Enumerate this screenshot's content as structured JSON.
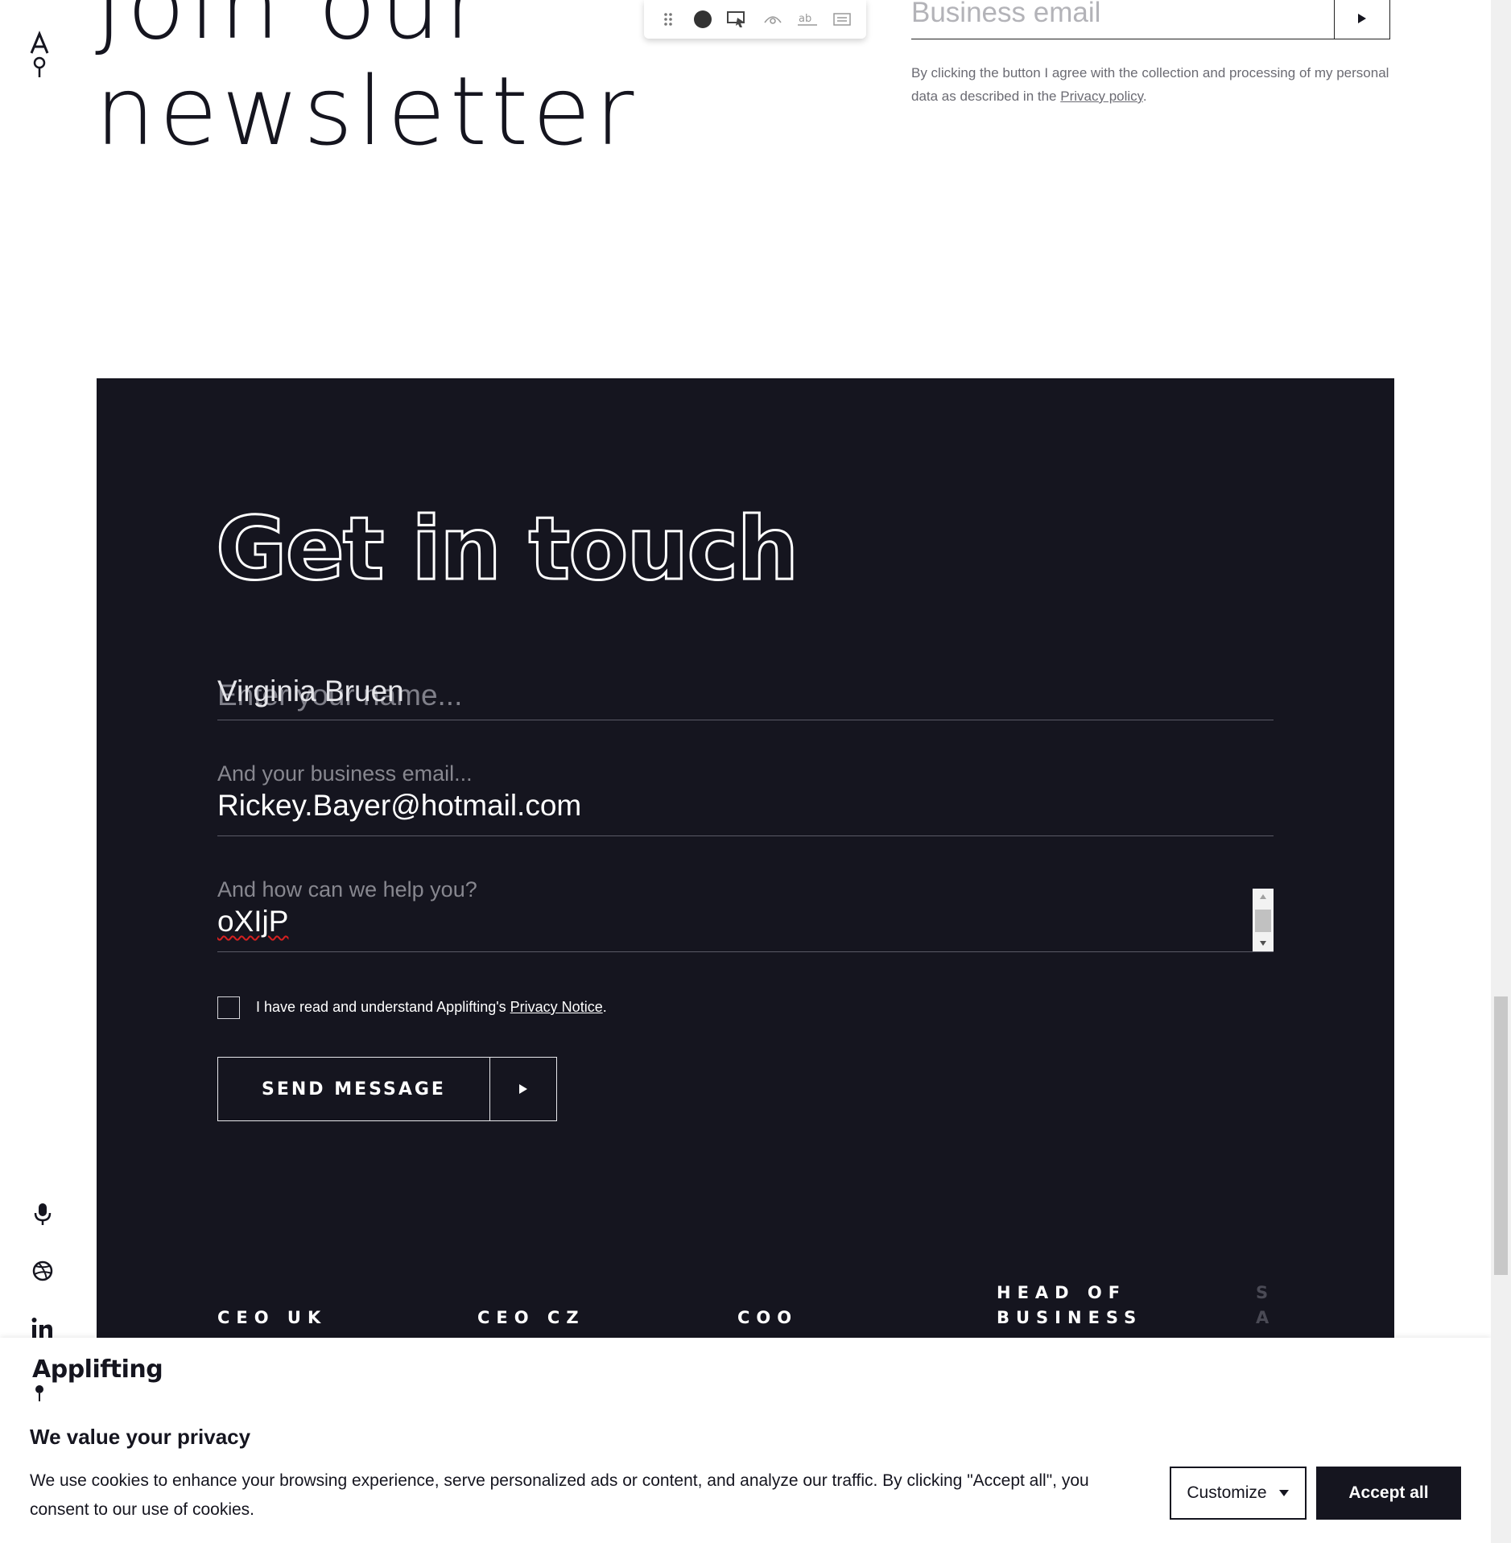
{
  "newsletter": {
    "title_line1": "Join our",
    "title_line2": "newsletter",
    "email_placeholder": "Business email",
    "consent_prefix": "By clicking the button I agree with the collection and processing of my personal data as described in the ",
    "consent_link": "Privacy policy",
    "consent_suffix": "."
  },
  "toolbar": {
    "icons": [
      "drag-handle-icon",
      "record-icon",
      "select-element-icon",
      "eye-icon",
      "text-icon",
      "comment-icon"
    ]
  },
  "contact": {
    "title": "Get in touch",
    "name_placeholder": "Enter your name...",
    "name_value": "Virginia Bruen",
    "email_label": "And your business email...",
    "email_value": "Rickey.Bayer@hotmail.com",
    "help_label": "And how can we help you?",
    "help_value": "oXIjP",
    "privacy_prefix": "I have read and understand Applifting's ",
    "privacy_link": "Privacy Notice",
    "privacy_suffix": ".",
    "send_label": "SEND MESSAGE"
  },
  "roles": {
    "ceo_uk": "CEO UK",
    "ceo_cz": "CEO CZ",
    "coo": "COO",
    "head_of_business": "HEAD OF\nBUSINESS",
    "partial": "S\nA"
  },
  "cookie": {
    "logo": "Applifting",
    "title": "We value your privacy",
    "text": "We use cookies to enhance your browsing experience, serve personalized ads or content, and analyze our traffic. By clicking \"Accept all\", you consent to our use of cookies.",
    "customize_label": "Customize",
    "accept_label": "Accept all"
  },
  "social": [
    "microphone-icon",
    "dribbble-icon",
    "linkedin-icon"
  ],
  "colors": {
    "dark_panel": "#15151f",
    "text_primary": "#15151f",
    "placeholder": "#87878f",
    "white": "#ffffff"
  }
}
